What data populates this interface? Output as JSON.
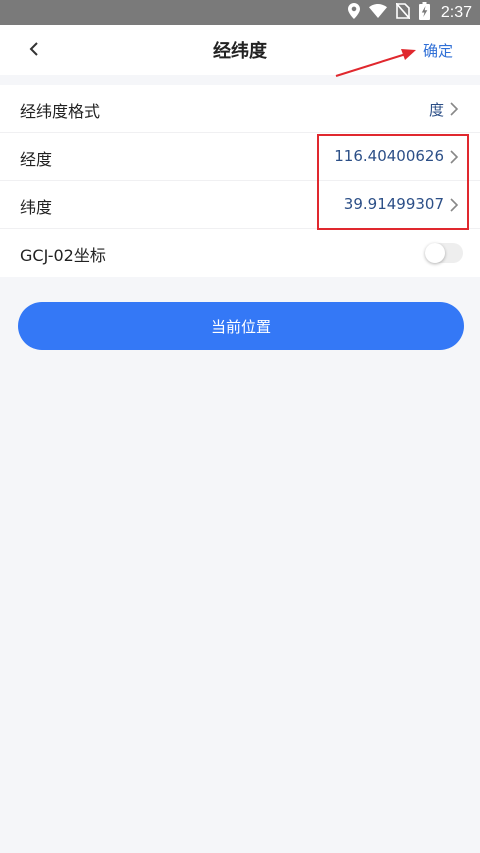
{
  "status_bar": {
    "time": "2:37",
    "icons": [
      "location-icon",
      "wifi-icon",
      "no-sim-icon",
      "battery-charging-icon"
    ]
  },
  "nav": {
    "title": "经纬度",
    "confirm_label": "确定",
    "back_icon": "chevron-left-icon"
  },
  "settings": [
    {
      "label": "经纬度格式",
      "value": "度"
    },
    {
      "label": "经度",
      "value": "116.40400626"
    },
    {
      "label": "纬度",
      "value": "39.91499307"
    },
    {
      "label": "GCJ-02坐标",
      "toggle_on": false
    }
  ],
  "action_button": {
    "label": "当前位置"
  },
  "colors": {
    "accent": "#3478f6",
    "value_text": "#2c4f87",
    "annotation": "#e0282e"
  }
}
